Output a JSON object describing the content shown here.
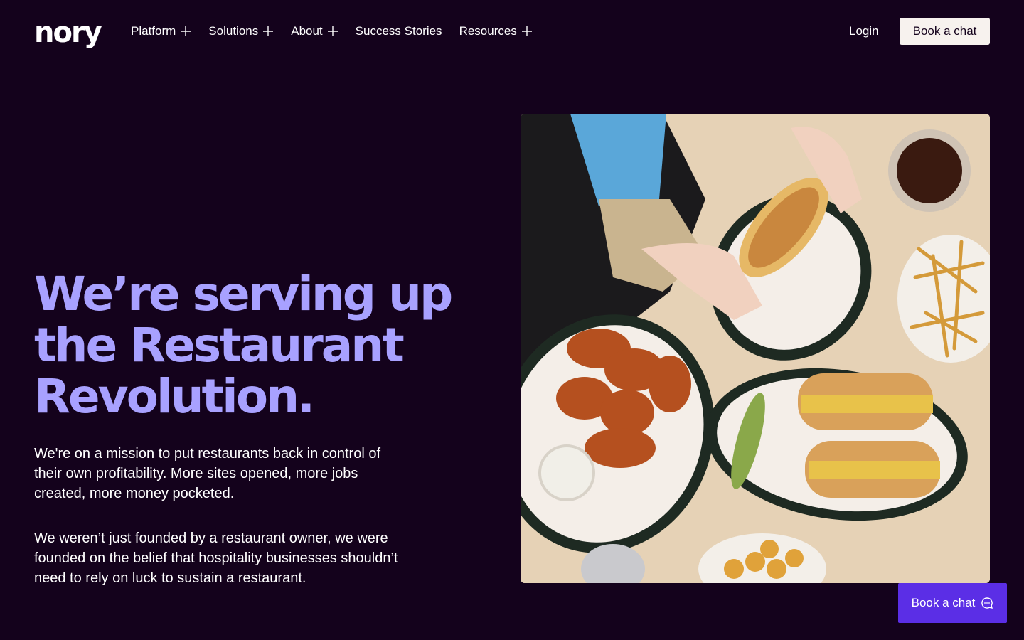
{
  "brand": {
    "logo_text": "nory"
  },
  "nav": {
    "items": [
      {
        "label": "Platform",
        "icon": "plus-icon"
      },
      {
        "label": "Solutions",
        "icon": "plus-icon"
      },
      {
        "label": "About",
        "icon": "plus-icon"
      },
      {
        "label": "Success Stories"
      },
      {
        "label": "Resources",
        "icon": "plus-icon"
      }
    ],
    "login_label": "Login",
    "cta_label": "Book a chat"
  },
  "hero": {
    "title_line_1": "We’re serving up",
    "title_line_2": "the Restaurant",
    "title_line_3": "Revolution.",
    "paragraph_1": "We're on a mission to put restaurants back in control of their own profitability. More sites opened, more jobs created, more money pocketed.",
    "paragraph_2": "We weren’t just founded by a restaurant owner, we were  founded on the belief that hospitality businesses shouldn’t need to rely on luck to sustain a restaurant."
  },
  "floating_cta": {
    "label": "Book a chat",
    "icon": "chat-bubble-icon"
  },
  "colors": {
    "background": "#14021c",
    "accent_lilac": "#a8a1ff",
    "cta_light": "#f7f2ee",
    "floating_purple": "#5b2ee6"
  }
}
